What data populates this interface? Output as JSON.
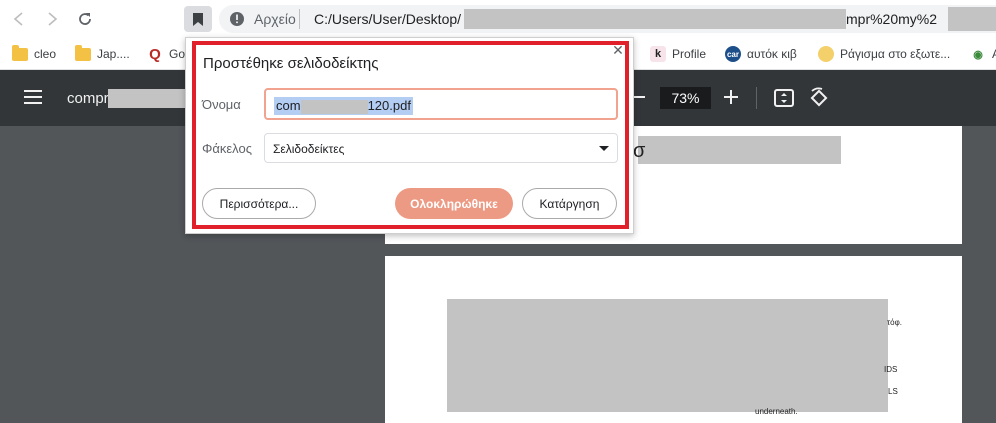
{
  "browser": {
    "address_label": "Αρχείο",
    "url_start": "C:/Users/User/Desktop/",
    "url_end": "mpr%20my%2",
    "bookmarks": [
      {
        "label": "cleo",
        "icon": "folder-icon"
      },
      {
        "label": "Jap....",
        "icon": "folder-icon"
      },
      {
        "label": "Go",
        "icon": "quora-icon"
      },
      {
        "label": "Profile",
        "icon": "k-favicon-icon"
      },
      {
        "label": "αυτόκ κιβ",
        "icon": "car-favicon-icon"
      },
      {
        "label": "Ράγισμα στο εξωτε...",
        "icon": "bulb-favicon-icon"
      },
      {
        "label": "A",
        "icon": "eye-favicon-icon"
      }
    ]
  },
  "pdf_viewer": {
    "title_prefix": "compr",
    "zoom": "73%",
    "page_snippets": [
      "σ",
      "τόφ.",
      "IDS",
      "LS",
      "underneath."
    ]
  },
  "dialog": {
    "title": "Προστέθηκε σελιδοδείκτης",
    "name_label": "Όνομα",
    "name_value_start": "com",
    "name_value_end": "120.pdf",
    "folder_label": "Φάκελος",
    "folder_value": "Σελιδοδείκτες",
    "more_button": "Περισσότερα...",
    "done_button": "Ολοκληρώθηκε",
    "remove_button": "Κατάργηση",
    "close_glyph": "✕"
  },
  "colors": {
    "highlight": "#e0202b",
    "primary_button": "#ed9a84",
    "pdf_toolbar": "#323639",
    "viewer_bg": "#525659"
  }
}
